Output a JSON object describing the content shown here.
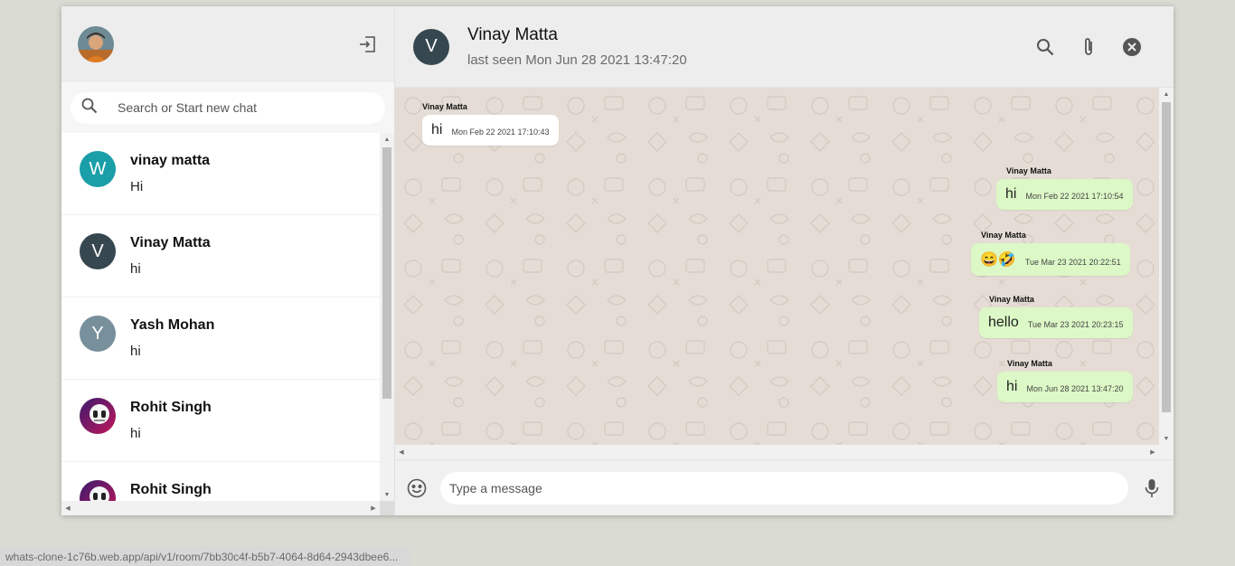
{
  "sidebar": {
    "search_placeholder": "Search or Start new chat",
    "chats": [
      {
        "initial": "W",
        "name": "vinay matta",
        "last": "Hi",
        "color": "#1a9ea8"
      },
      {
        "initial": "V",
        "name": "Vinay Matta",
        "last": "hi",
        "color": "#37474f"
      },
      {
        "initial": "Y",
        "name": "Yash Mohan",
        "last": "hi",
        "color": "#78909c"
      },
      {
        "initial": "",
        "name": "Rohit Singh",
        "last": "hi",
        "color": "#6a1b9a"
      },
      {
        "initial": "",
        "name": "Rohit Singh",
        "last": "",
        "color": "#6a1b9a"
      }
    ]
  },
  "chat": {
    "avatar_initial": "V",
    "name": "Vinay Matta",
    "last_seen": "last seen Mon Jun 28 2021 13:47:20",
    "messages": [
      {
        "from": "Vinay Matta",
        "text": "hi",
        "time": "Mon Feb 22 2021 17:10:43",
        "direction": "in"
      },
      {
        "from": "Vinay Matta",
        "text": "hi",
        "time": "Mon Feb 22 2021 17:10:54",
        "direction": "out"
      },
      {
        "from": "Vinay Matta",
        "text": "😄🤣",
        "time": "Tue Mar 23 2021 20:22:51",
        "direction": "out"
      },
      {
        "from": "Vinay Matta",
        "text": "hello",
        "time": "Tue Mar 23 2021 20:23:15",
        "direction": "out"
      },
      {
        "from": "Vinay Matta",
        "text": "hi",
        "time": "Mon Jun 28 2021 13:47:20",
        "direction": "out"
      }
    ],
    "input_placeholder": "Type a message"
  },
  "status_url": "whats-clone-1c76b.web.app/api/v1/room/7bb30c4f-b5b7-4064-8d64-2943dbee6..."
}
